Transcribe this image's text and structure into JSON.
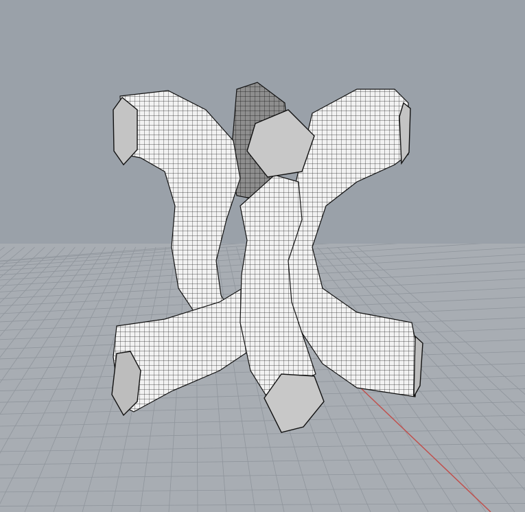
{
  "viewport": {
    "projection": "perspective",
    "display_mode": "shaded-wireframe",
    "background_color": "#9aa1a9",
    "grid_color": "#a8adb3",
    "grid_line_color": "#8f959c",
    "x_axis_color": "#c0504d"
  },
  "model": {
    "description_icon": "twisted-pentagonal-sweep-mesh",
    "surface_color": "#ffffff",
    "mesh_line_color": "#1a1a1a",
    "cap_color": "#c8c8c8",
    "arms": [
      "top-left",
      "top-center",
      "top-right",
      "bottom-left",
      "bottom-center",
      "bottom-right"
    ]
  }
}
